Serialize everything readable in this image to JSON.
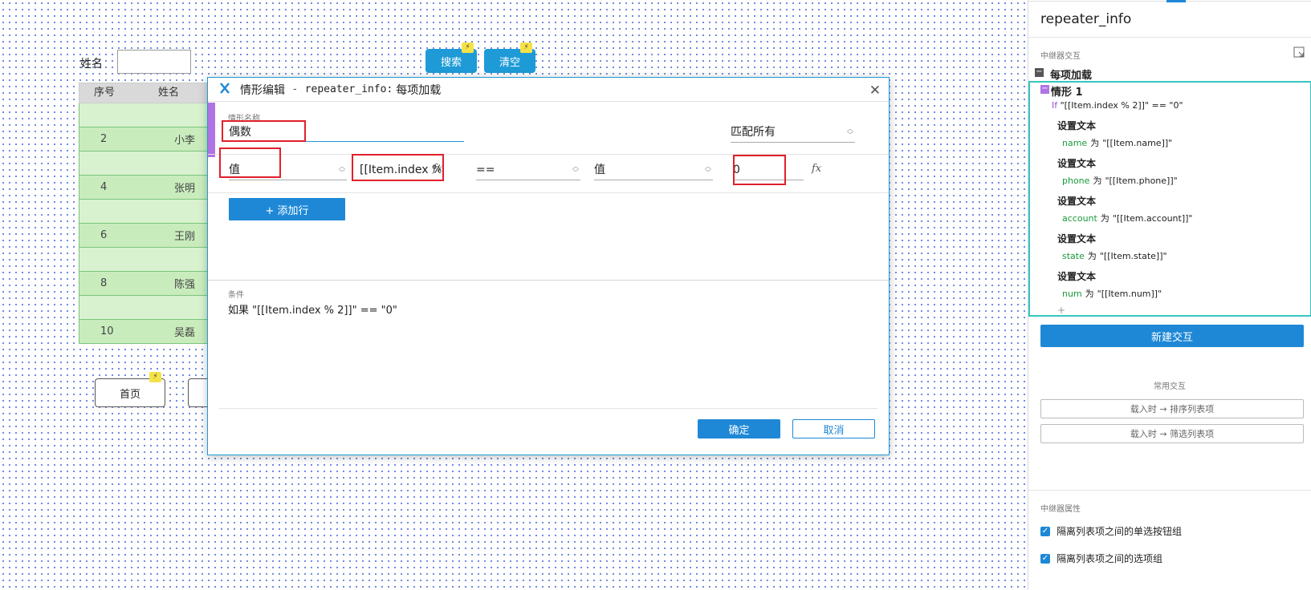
{
  "canvas": {
    "name_label": "姓名",
    "search_button": "搜索",
    "clear_button": "清空",
    "bolt_icon": "⚡",
    "table": {
      "headers": [
        "序号",
        "姓名"
      ],
      "rows": [
        {
          "index": "",
          "name": ""
        },
        {
          "index": "2",
          "name": "小李"
        },
        {
          "index": "",
          "name": ""
        },
        {
          "index": "4",
          "name": "张明"
        },
        {
          "index": "",
          "name": ""
        },
        {
          "index": "6",
          "name": "王刚"
        },
        {
          "index": "",
          "name": ""
        },
        {
          "index": "8",
          "name": "陈强"
        },
        {
          "index": "",
          "name": ""
        },
        {
          "index": "10",
          "name": "吴磊"
        }
      ]
    },
    "first_page_button": "首页"
  },
  "dialog": {
    "title": "情形编辑",
    "separator": "-",
    "subtitle_repeater": "repeater_info:",
    "subtitle_event": "每项加载",
    "close_icon": "✕",
    "case_name_label": "情形名称",
    "case_name_value": "偶数",
    "match_mode": "匹配所有",
    "condition_row": {
      "left_type": "值",
      "left_value": "[[Item.index %",
      "operator": "==",
      "right_type": "值",
      "right_value": "0"
    },
    "fx_icon": "fx",
    "add_row_button": "+ 添加行",
    "condition_label": "条件",
    "condition_text": "如果 \"[[Item.index % 2]]\" == \"0\"",
    "ok_button": "确定",
    "cancel_button": "取消"
  },
  "panel": {
    "title": "repeater_info",
    "interactions_label": "中继器交互",
    "event_name": "每项加载",
    "case_name": "情形 1",
    "if_keyword": "If",
    "if_condition": "\"[[Item.index % 2]]\" == \"0\"",
    "actions": [
      {
        "header": "设置文本",
        "target": "name",
        "word": "为",
        "value": "\"[[Item.name]]\""
      },
      {
        "header": "设置文本",
        "target": "phone",
        "word": "为",
        "value": "\"[[Item.phone]]\""
      },
      {
        "header": "设置文本",
        "target": "account",
        "word": "为",
        "value": "\"[[Item.account]]\""
      },
      {
        "header": "设置文本",
        "target": "state",
        "word": "为",
        "value": "\"[[Item.state]]\""
      },
      {
        "header": "设置文本",
        "target": "num",
        "word": "为",
        "value": "\"[[Item.num]]\""
      }
    ],
    "add_plus": "+",
    "new_interaction_button": "新建交互",
    "common_label": "常用交互",
    "common_items": [
      "载入时 → 排序列表项",
      "载入时 → 筛选列表项"
    ],
    "properties_label": "中继器属性",
    "checkboxes": [
      "隔离列表项之间的单选按钮组",
      "隔离列表项之间的选项组"
    ],
    "check_mark": "✓",
    "accent_color": "#1e88d6"
  }
}
